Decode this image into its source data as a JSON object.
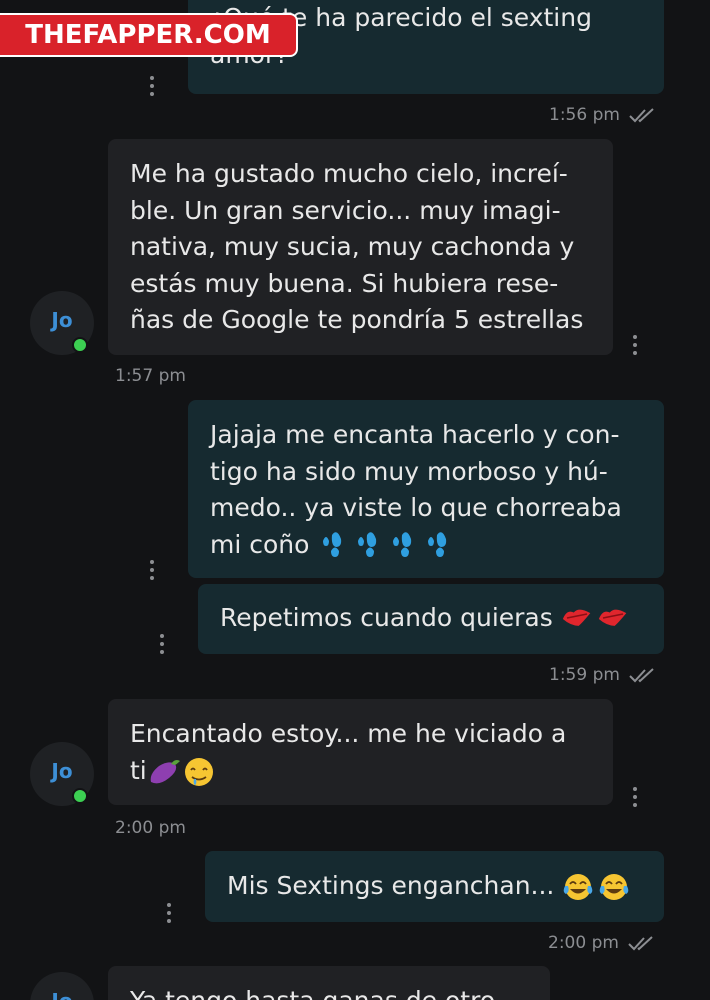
{
  "watermark": {
    "text": "THEFAPPER.COM"
  },
  "contact": {
    "initials": "Jo",
    "online_color": "#3ccf52"
  },
  "colors": {
    "outgoing": "#162a30",
    "incoming": "#202124",
    "background": "#121315",
    "accent": "#3d8fd6"
  },
  "messages": [
    {
      "dir": "out",
      "text": "¿Qué te ha parecido el sexting\namor?",
      "time": "1:56 pm",
      "ticks": "double-check-icon"
    },
    {
      "dir": "in",
      "text": "Me ha gustado mucho cielo, increí-\nble. Un gran servicio... muy imagi-\nnativa, muy sucia, muy cachonda y\nestás muy buena. Si hubiera rese-\nñas de Google te pondría 5 estrellas",
      "time": "1:57 pm"
    },
    {
      "dir": "out",
      "text": "Jajaja me encanta hacerlo y con-\ntigo ha sido muy morboso y hú-\nmedo.. ya viste lo que chorreaba\nmi coño",
      "emoji": "sweat-droplets-icon"
    },
    {
      "dir": "out",
      "text": "Repetimos cuando quieras",
      "emoji": "kiss-mark-icon",
      "time": "1:59 pm",
      "ticks": "double-check-icon"
    },
    {
      "dir": "in",
      "text": "Encantado estoy... me he viciado a\nti",
      "emoji": "eggplant-drooling-face-icon",
      "time": "2:00 pm"
    },
    {
      "dir": "out",
      "text": "Mis Sextings enganchan...",
      "emoji": "tears-of-joy-icon",
      "time": "2:00 pm",
      "ticks": "double-check-icon"
    },
    {
      "dir": "in",
      "text": "Ya tengo hasta ganas de otro"
    }
  ]
}
